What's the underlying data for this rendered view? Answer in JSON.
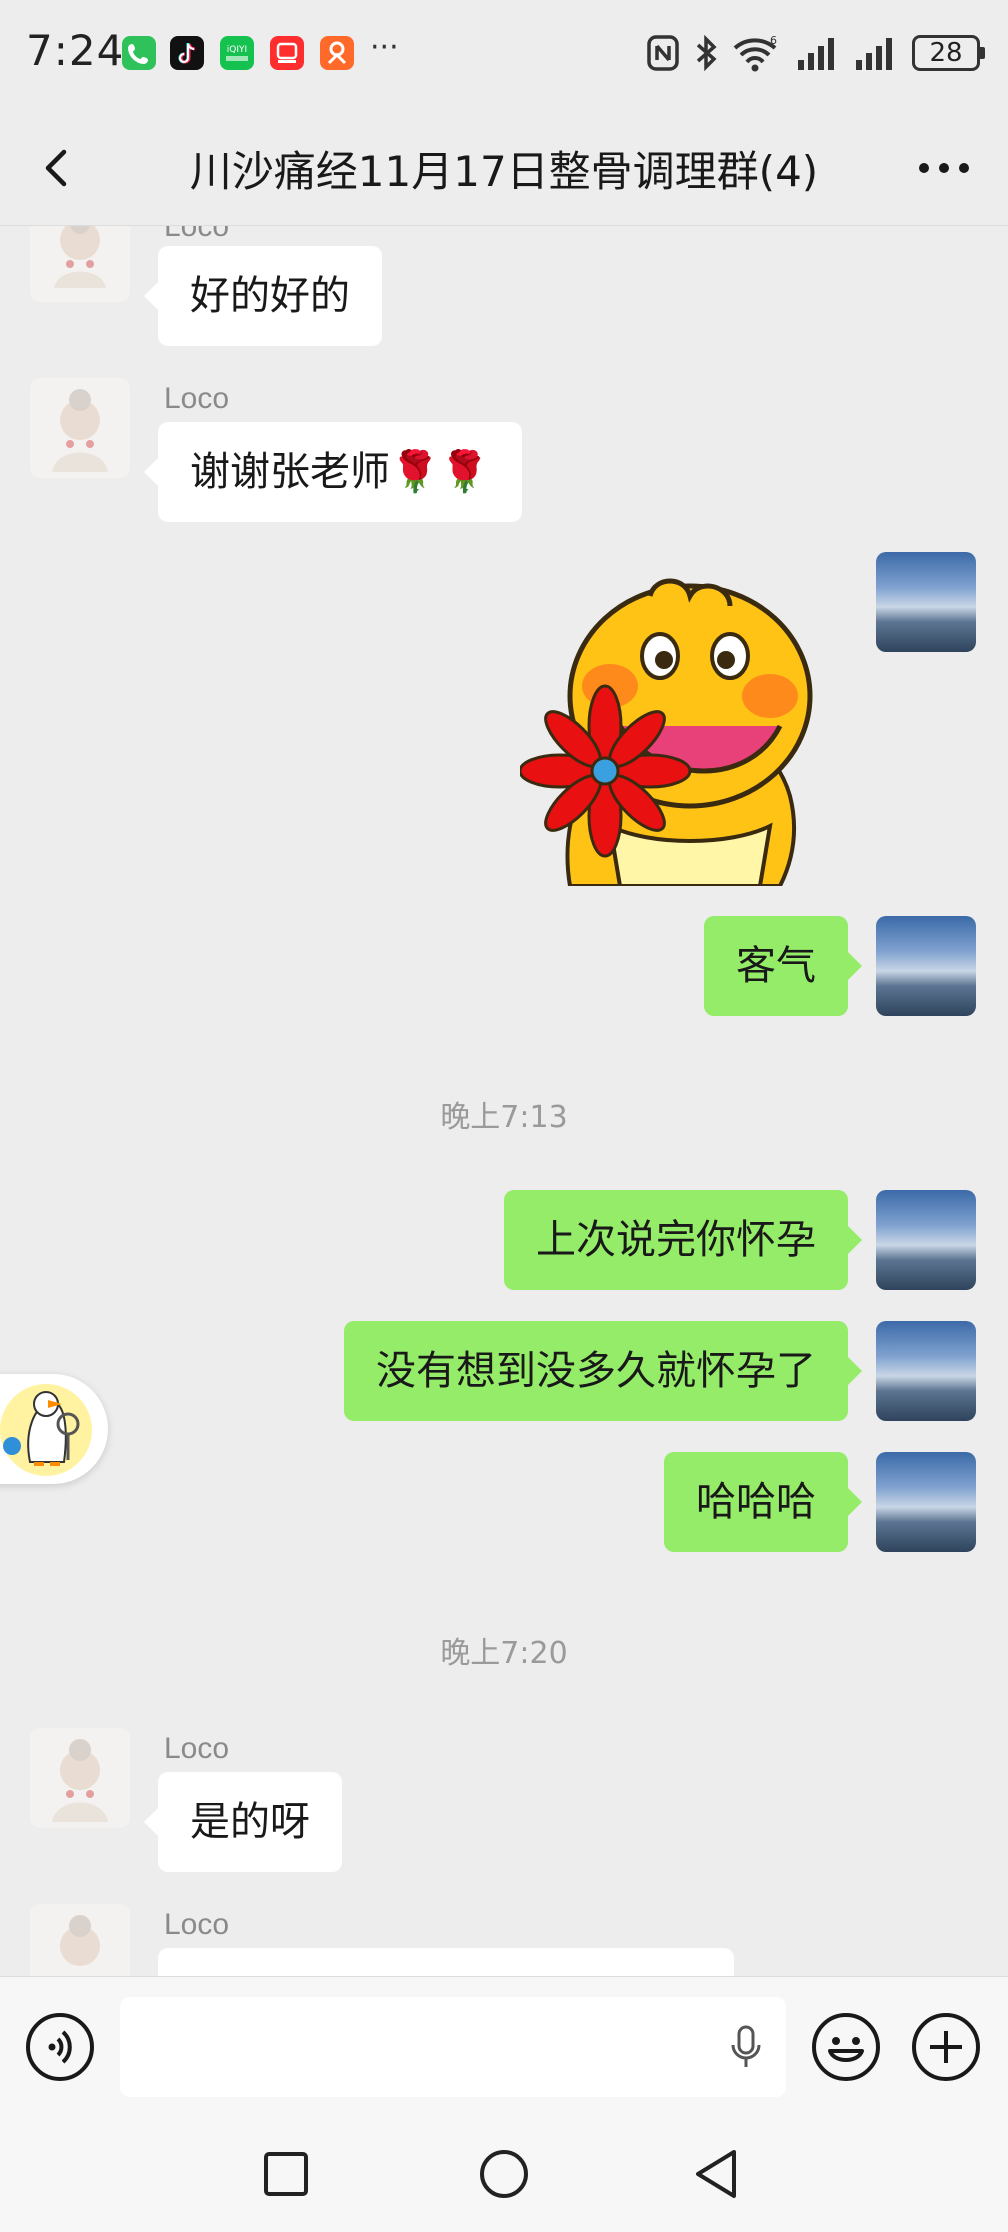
{
  "status_bar": {
    "time": "7:24",
    "battery": "28",
    "overflow": "···"
  },
  "nav": {
    "title": "川沙痛经11月17日整骨调理群(4)"
  },
  "messages": [
    {
      "sender": "Loco",
      "text": "好的好的"
    },
    {
      "sender": "Loco",
      "text": "谢谢张老师🌹🌹"
    },
    {
      "sender": "me",
      "type": "sticker"
    },
    {
      "sender": "me",
      "text": "客气"
    },
    {
      "timestamp": "晚上7:13"
    },
    {
      "sender": "me",
      "text": "上次说完你怀孕"
    },
    {
      "sender": "me",
      "text": "没有想到没多久就怀孕了"
    },
    {
      "sender": "me",
      "text": "哈哈哈"
    },
    {
      "timestamp": "晚上7:20"
    },
    {
      "sender": "Loco",
      "text": "是的呀"
    },
    {
      "sender": "Loco",
      "text": ""
    }
  ],
  "colors": {
    "background": "#ededed",
    "outgoing_bubble": "#95ec69",
    "incoming_bubble": "#ffffff"
  },
  "icons": {
    "voice": "voice-icon",
    "emoji": "emoji-icon",
    "plus": "plus-icon",
    "mic": "mic-icon"
  }
}
